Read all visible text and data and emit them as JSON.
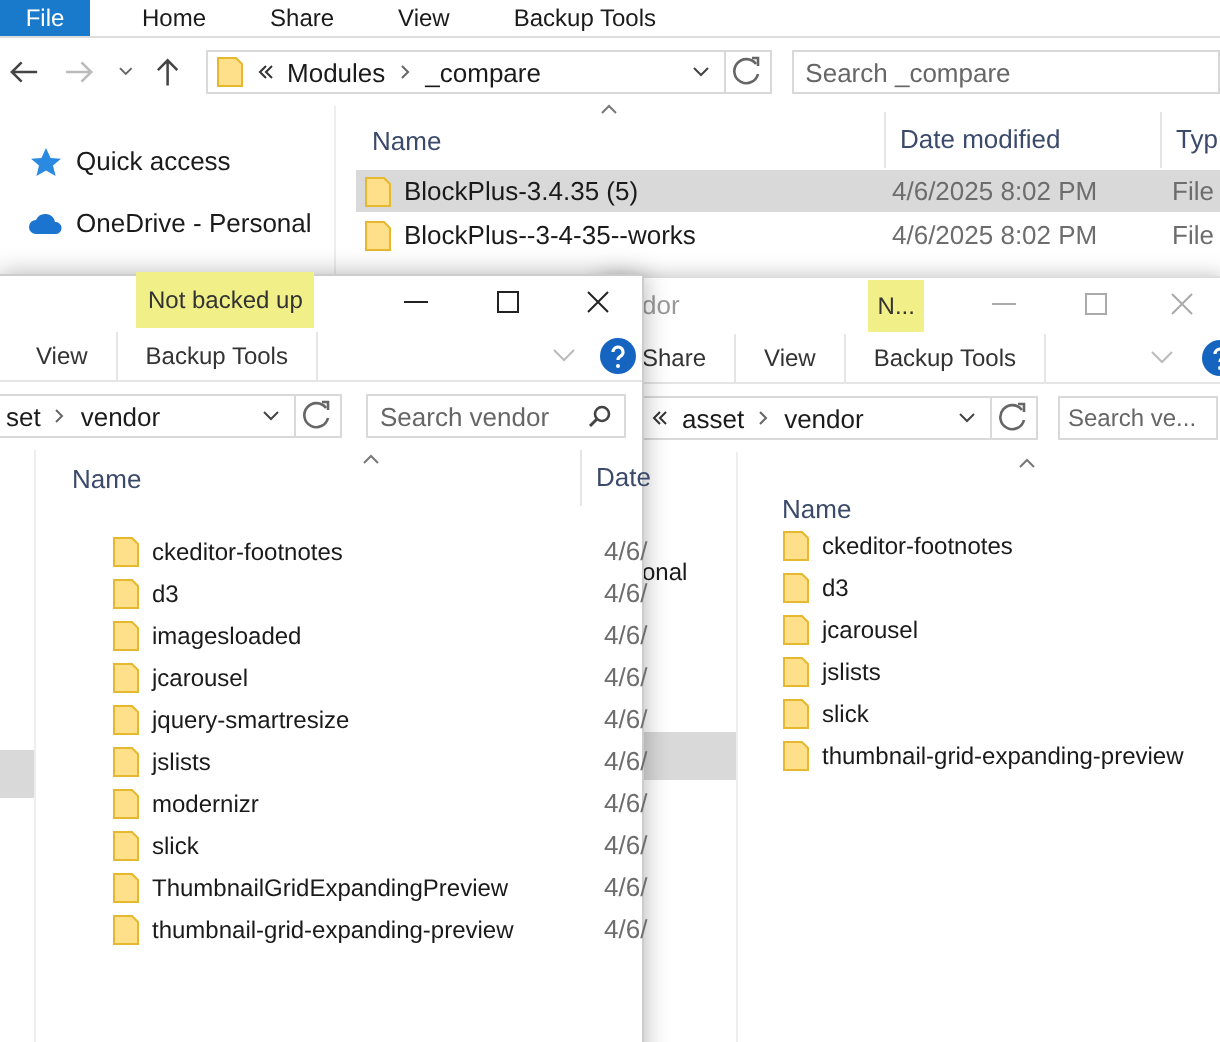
{
  "back_window": {
    "ribbon_tabs": [
      {
        "label": "File",
        "selected": true
      },
      {
        "label": "Home",
        "selected": false
      },
      {
        "label": "Share",
        "selected": false
      },
      {
        "label": "View",
        "selected": false
      },
      {
        "label": "Backup Tools",
        "selected": false
      }
    ],
    "address": {
      "path": [
        "Modules",
        "_compare"
      ]
    },
    "search": {
      "placeholder": "Search _compare"
    },
    "sidebar": {
      "items": [
        {
          "label": "Quick access",
          "kind": "star"
        },
        {
          "label": "OneDrive - Personal",
          "kind": "cloud"
        }
      ]
    },
    "columns": [
      "Name",
      "Date modified",
      "Typ"
    ],
    "rows": [
      {
        "name": "BlockPlus-3.4.35 (5)",
        "date": "4/6/2025 8:02 PM",
        "type": "File",
        "selected": true
      },
      {
        "name": "BlockPlus--3-4-35--works",
        "date": "4/6/2025 8:02 PM",
        "type": "File",
        "selected": false
      }
    ]
  },
  "right_window": {
    "title": "dor",
    "title_tag": "N...",
    "ribbon_tabs": [
      {
        "label": "Share",
        "selected": false
      },
      {
        "label": "View",
        "selected": false
      },
      {
        "label": "Backup Tools",
        "selected": false
      }
    ],
    "address": {
      "path": [
        "asset",
        "vendor"
      ]
    },
    "search": {
      "placeholder": "Search ve..."
    },
    "sidebar": {
      "items": [
        {
          "label": "onal",
          "selected": false
        },
        {
          "selected": true
        }
      ]
    },
    "columns": [
      "Name"
    ],
    "rows": [
      {
        "name": "ckeditor-footnotes"
      },
      {
        "name": "d3"
      },
      {
        "name": "jcarousel"
      },
      {
        "name": "jslists"
      },
      {
        "name": "slick"
      },
      {
        "name": "thumbnail-grid-expanding-preview"
      }
    ]
  },
  "front_window": {
    "title_tag": "Not backed up",
    "ribbon_tabs": [
      {
        "label": "View",
        "selected": false
      },
      {
        "label": "Backup Tools",
        "selected": false
      }
    ],
    "address": {
      "path": [
        "set",
        "vendor"
      ]
    },
    "search": {
      "placeholder": "Search vendor"
    },
    "sidebar": {
      "items": [
        {
          "selected": true
        }
      ]
    },
    "columns": [
      "Name",
      "Date"
    ],
    "rows": [
      {
        "name": "ckeditor-footnotes",
        "date": "4/6/"
      },
      {
        "name": "d3",
        "date": "4/6/"
      },
      {
        "name": "imagesloaded",
        "date": "4/6/"
      },
      {
        "name": "jcarousel",
        "date": "4/6/"
      },
      {
        "name": "jquery-smartresize",
        "date": "4/6/"
      },
      {
        "name": "jslists",
        "date": "4/6/"
      },
      {
        "name": "modernizr",
        "date": "4/6/"
      },
      {
        "name": "slick",
        "date": "4/6/"
      },
      {
        "name": "ThumbnailGridExpandingPreview",
        "date": "4/6/"
      },
      {
        "name": "thumbnail-grid-expanding-preview",
        "date": "4/6/"
      }
    ]
  }
}
